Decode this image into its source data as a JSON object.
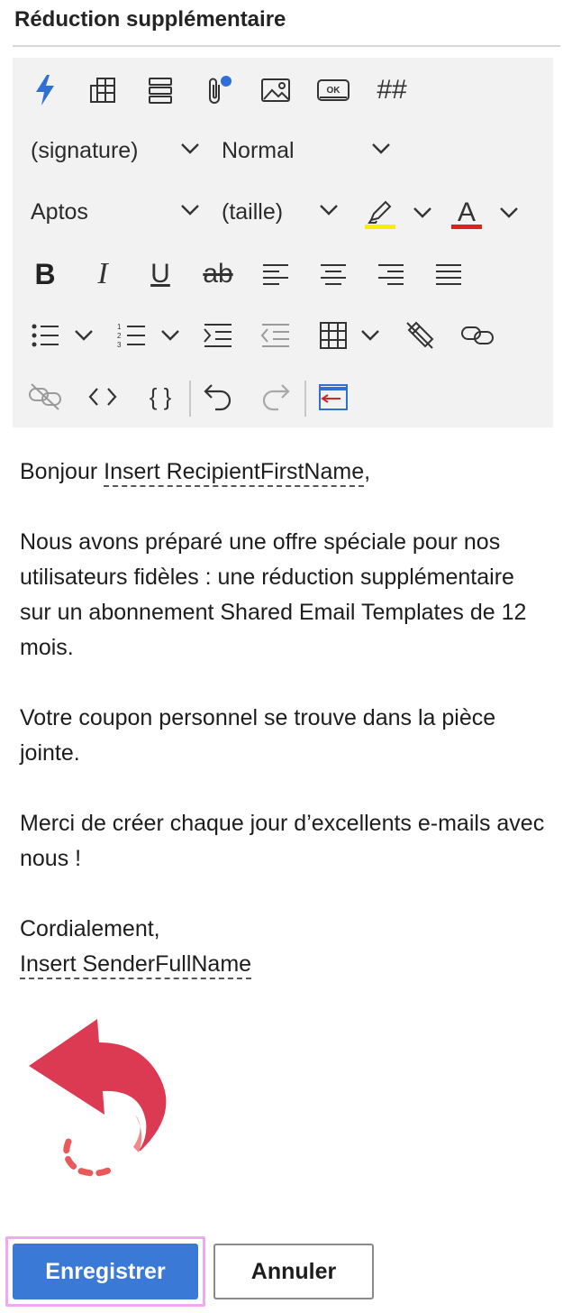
{
  "template": {
    "title": "Réduction supplémentaire"
  },
  "toolbar": {
    "signature_dropdown": "(signature)",
    "style_dropdown": "Normal",
    "font_dropdown": "Aptos",
    "size_dropdown": "(taille)",
    "highlight_color": "#f5f000",
    "font_color": "#e02020",
    "font_color_glyph": "A",
    "bold_glyph": "B",
    "italic_glyph": "I",
    "underline_glyph": "U",
    "strike_glyph": "ab",
    "hash_glyph": "##",
    "braces_glyph": "{ }",
    "ok_glyph": "OK",
    "accent_color": "#3a79d6"
  },
  "body": {
    "greeting_prefix": "Bonjour ",
    "recipient_placeholder": "Insert RecipientFirstName",
    "greeting_suffix": ",",
    "paragraph1": "Nous avons préparé une offre spéciale pour nos utilisateurs fidèles : une réduction supplémentaire sur un abonnement Shared Email Templates de 12 mois.",
    "paragraph2": "Votre coupon personnel se trouve dans la pièce jointe.",
    "paragraph3": "Merci de créer chaque jour d’excellents e-mails avec nous !",
    "closing": "Cordialement,",
    "sender_placeholder": "Insert SenderFullName"
  },
  "actions": {
    "save_label": "Enregistrer",
    "cancel_label": "Annuler"
  }
}
